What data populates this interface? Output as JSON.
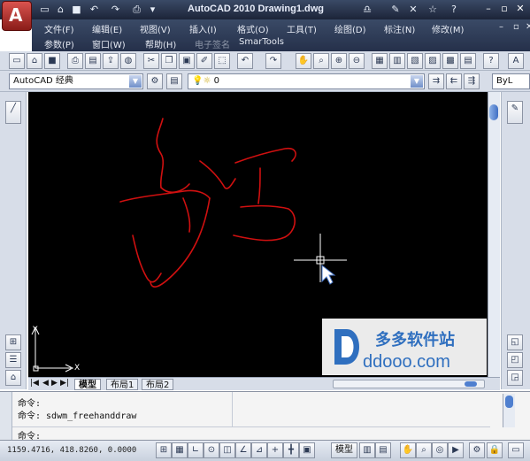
{
  "window": {
    "title": "AutoCAD 2010    Drawing1.dwg"
  },
  "menu": {
    "row1": [
      "文件(F)",
      "编辑(E)",
      "视图(V)",
      "插入(I)",
      "格式(O)",
      "工具(T)",
      "绘图(D)",
      "标注(N)",
      "修改(M)"
    ],
    "row2": [
      "参数(P)",
      "窗口(W)",
      "帮助(H)",
      "电子签名",
      "SmarTools"
    ]
  },
  "toolbar": {
    "workspace": "AutoCAD 经典",
    "layer": "0",
    "linetype_partial": "ByL"
  },
  "tabs": [
    "模型",
    "布局1",
    "布局2"
  ],
  "command_window": {
    "lines": [
      "命令:",
      "命令: sdwm_freehanddraw"
    ],
    "prompt": "命令:"
  },
  "statusbar": {
    "coordinates": "1159.4716, 418.8260, 0.0000",
    "model_label": "模型"
  },
  "ucs": {
    "x_label": "X",
    "y_label": "Y"
  },
  "watermark": {
    "name": "多多软件站",
    "url": "ddooo.com"
  },
  "colors": {
    "sketch_stroke": "#d01010",
    "canvas_bg": "#000000",
    "crosshair": "#ffffff",
    "title_bar": "#2a3550"
  },
  "icons": {
    "app_logo": "autocad-a-logo",
    "left_palette": [
      "line-tool-icon"
    ],
    "left_palette_bottom": [
      "dimension-icon",
      "spacing-icon",
      "text-icon"
    ],
    "right_palette": [
      "brush-icon"
    ],
    "right_palette_bottom": [
      "shape-icon",
      "shape-icon",
      "shape-icon"
    ]
  }
}
